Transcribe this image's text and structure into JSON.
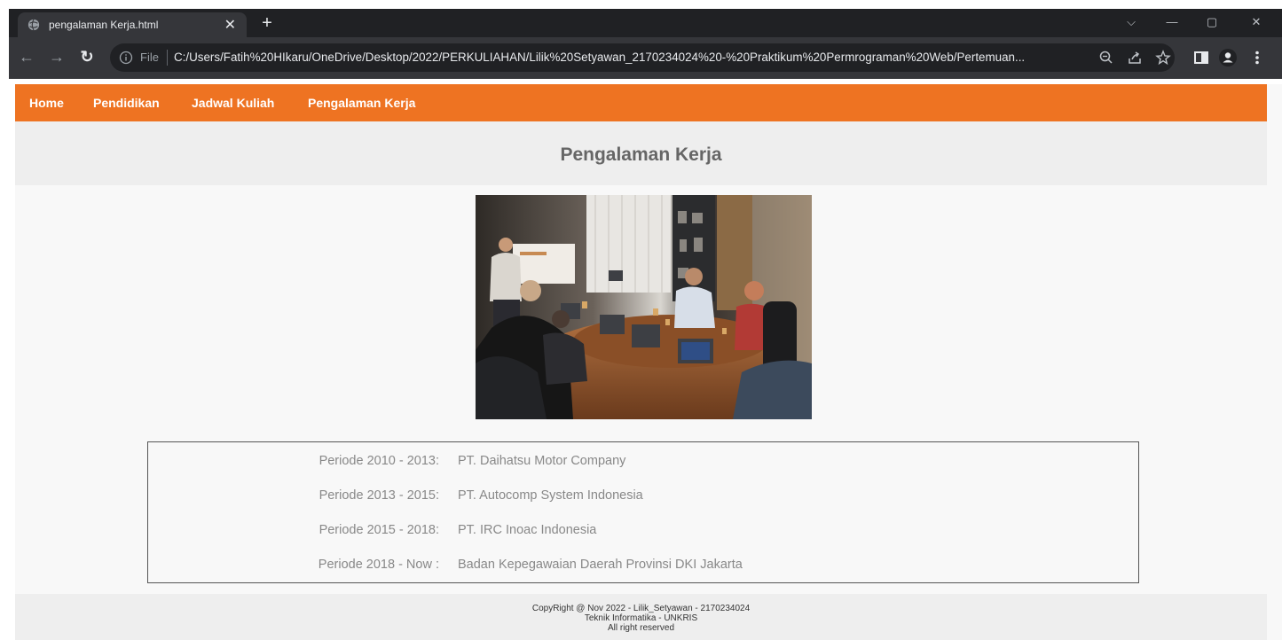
{
  "browser": {
    "tab_title": "pengalaman Kerja.html",
    "close_glyph": "✕",
    "new_tab_glyph": "+",
    "window_controls": [
      "⌵",
      "—",
      "▢",
      "✕"
    ],
    "omnibox_scheme": "File",
    "omnibox_url": "C:/Users/Fatih%20HIkaru/OneDrive/Desktop/2022/PERKULIAHAN/Lilik%20Setyawan_2170234024%20-%20Praktikum%20Permrograman%20Web/Pertemuan..."
  },
  "nav": {
    "items": [
      "Home",
      "Pendidikan",
      "Jadwal Kuliah",
      "Pengalaman Kerja"
    ]
  },
  "header": {
    "title": "Pengalaman Kerja"
  },
  "experience": [
    {
      "period": "Periode 2010 - 2013:",
      "company": "PT. Daihatsu Motor Company"
    },
    {
      "period": "Periode 2013 - 2015:",
      "company": "PT. Autocomp System Indonesia"
    },
    {
      "period": "Periode 2015 - 2018:",
      "company": "PT. IRC Inoac Indonesia"
    },
    {
      "period": "Periode 2018 - Now :",
      "company": "Badan Kepegawaian Daerah Provinsi DKI Jakarta"
    }
  ],
  "footer": {
    "line1": "CopyRight @ Nov 2022 - Lilik_Setyawan - 2170234024",
    "line2": "Teknik Informatika - UNKRIS",
    "line3": "All right reserved"
  },
  "colors": {
    "nav_bg": "#ee7322",
    "header_bg": "#eeeeee",
    "page_bg": "#f8f8f8",
    "text_muted": "#888888"
  }
}
